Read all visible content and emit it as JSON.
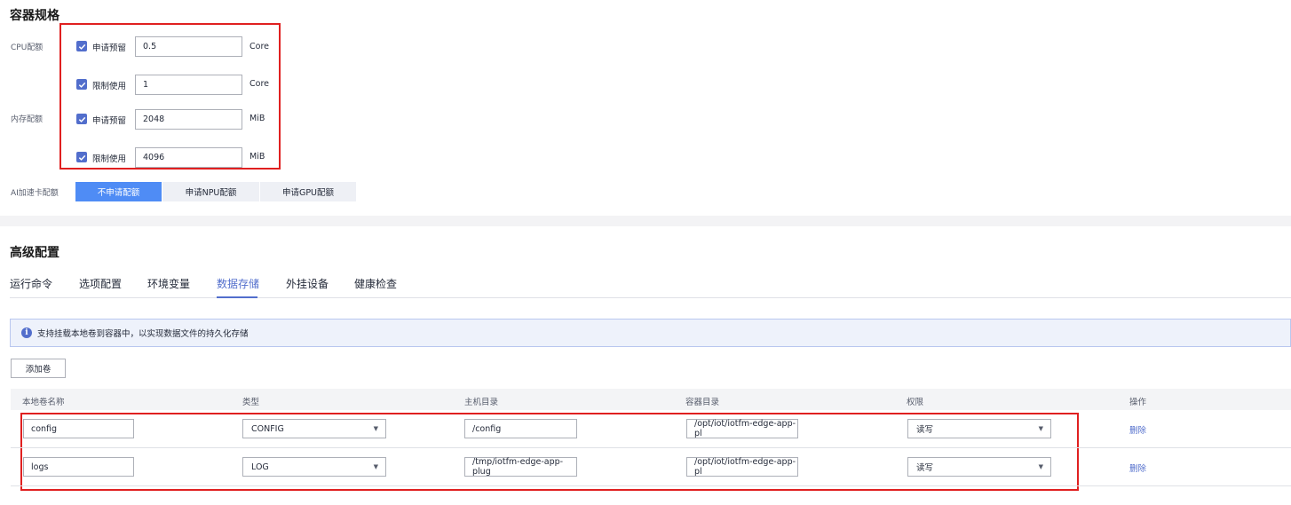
{
  "spec": {
    "title": "容器规格",
    "cpu_label": "CPU配额",
    "mem_label": "内存配额",
    "rows": [
      {
        "check_label": "申请预留",
        "value": "0.5",
        "unit": "Core"
      },
      {
        "check_label": "限制使用",
        "value": "1",
        "unit": "Core"
      },
      {
        "check_label": "申请预留",
        "value": "2048",
        "unit": "MiB"
      },
      {
        "check_label": "限制使用",
        "value": "4096",
        "unit": "MiB"
      }
    ],
    "ai_label": "AI加速卡配额",
    "ai_tabs": [
      "不申请配额",
      "申请NPU配额",
      "申请GPU配额"
    ],
    "ai_selected": "不申请配额"
  },
  "advanced": {
    "title": "高级配置",
    "tabs": [
      "运行命令",
      "选项配置",
      "环境变量",
      "数据存储",
      "外挂设备",
      "健康检查"
    ],
    "active_tab": "数据存储",
    "info": "支持挂载本地卷到容器中，以实现数据文件的持久化存储",
    "add_button": "添加卷",
    "columns": [
      "本地卷名称",
      "类型",
      "主机目录",
      "容器目录",
      "权限",
      "操作"
    ],
    "rows": [
      {
        "name": "config",
        "type": "CONFIG",
        "host_dir": "/config",
        "container_dir": "/opt/iot/iotfm-edge-app-pl",
        "permission": "读写",
        "action": "删除"
      },
      {
        "name": "logs",
        "type": "LOG",
        "host_dir": "/tmp/iotfm-edge-app-plug",
        "container_dir": "/opt/iot/iotfm-edge-app-pl",
        "permission": "读写",
        "action": "删除"
      }
    ]
  },
  "colors": {
    "accent": "#526ecc",
    "highlight_box": "#e02020",
    "ai_active": "#4f8cf5"
  }
}
